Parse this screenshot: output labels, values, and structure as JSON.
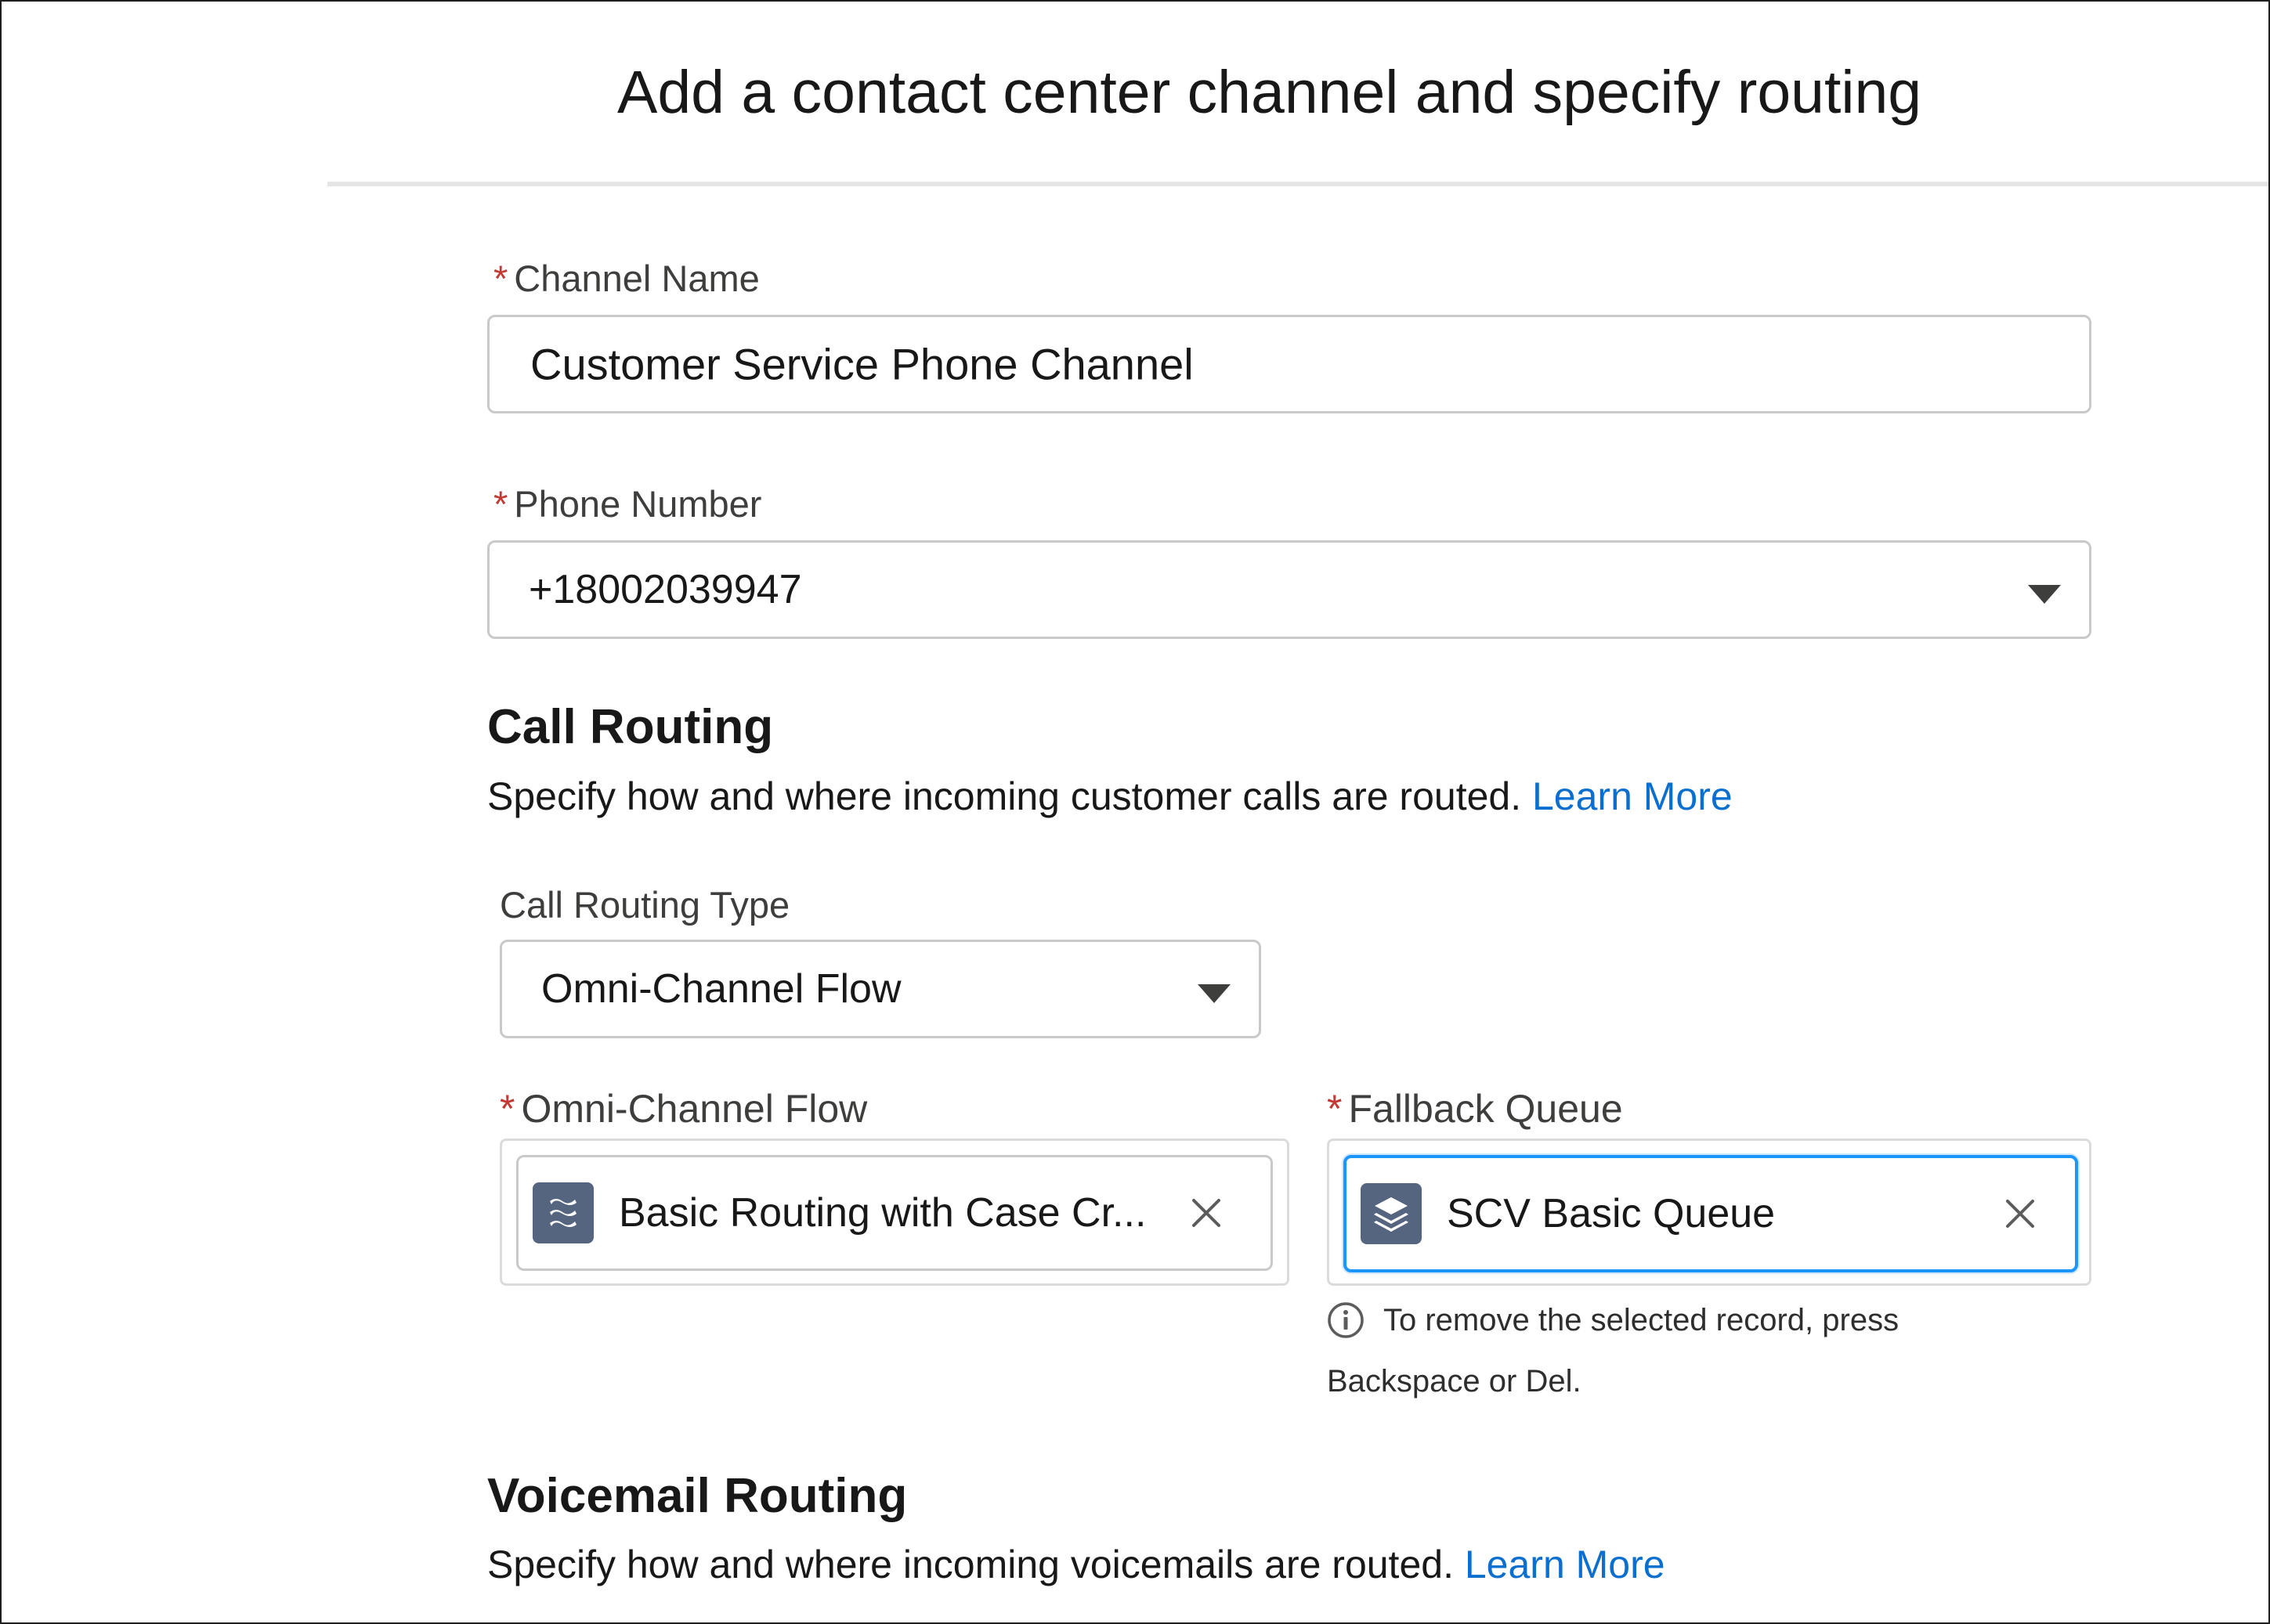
{
  "page": {
    "title": "Add a contact center channel and specify routing"
  },
  "channel_name": {
    "required_mark": "*",
    "label": "Channel Name",
    "value": "Customer Service Phone Channel"
  },
  "phone_number": {
    "required_mark": "*",
    "label": "Phone Number",
    "value": "+18002039947",
    "icon": "chevron-down-icon"
  },
  "call_routing": {
    "heading": "Call Routing",
    "description": "Specify how and where incoming customer calls are routed.",
    "learn_more": "Learn More",
    "routing_type": {
      "label": "Call Routing Type",
      "value": "Omni-Channel Flow",
      "icon": "chevron-down-icon"
    },
    "omni_flow": {
      "required_mark": "*",
      "label": "Omni-Channel Flow",
      "selected": "Basic Routing with Case Cr...",
      "icon": "flow-icon",
      "remove_icon": "close-icon"
    },
    "fallback_queue": {
      "required_mark": "*",
      "label": "Fallback Queue",
      "selected": "SCV Basic Queue",
      "icon": "queue-icon",
      "remove_icon": "close-icon",
      "help_line1": "To remove the selected record, press",
      "help_line2": "Backspace or Del."
    }
  },
  "voicemail_routing": {
    "heading": "Voicemail Routing",
    "description": "Specify how and where incoming voicemails are routed.",
    "learn_more": "Learn More"
  },
  "colors": {
    "accent": "#0b6fd0",
    "required": "#c23934",
    "focus": "#1b96ff",
    "icon_bg": "#56657f"
  }
}
